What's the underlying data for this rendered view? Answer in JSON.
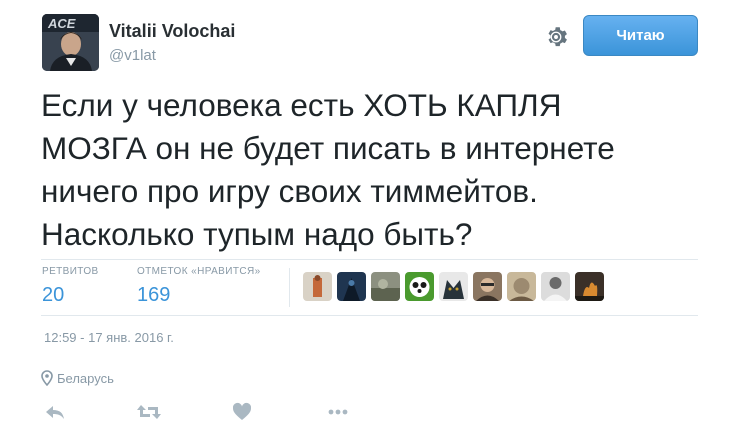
{
  "user": {
    "name": "Vitalii Volochai",
    "handle": "@v1lat",
    "avatar_icon": "user-avatar-photo",
    "avatar_logo_text": "ACE"
  },
  "follow_button": {
    "label": "Читаю",
    "color": "#3b94d9"
  },
  "tweet": {
    "lines": [
      "Если у человека есть ХОТЬ КАПЛЯ",
      "МОЗГА он не будет писать в интернете",
      "ничего про игру своих тиммейтов.",
      "Насколько тупым надо быть?"
    ]
  },
  "stats": {
    "retweets": {
      "label": "РЕТВИТОВ",
      "value": "20"
    },
    "likes": {
      "label": "ОТМЕТОК «НРАВИТСЯ»",
      "value": "169"
    }
  },
  "likers": [
    {
      "icon": "avatar-orange-figure",
      "color": "#c4683a"
    },
    {
      "icon": "avatar-dark-hero",
      "color": "#1f3550"
    },
    {
      "icon": "avatar-gray-scene",
      "color": "#6c7260"
    },
    {
      "icon": "avatar-panda",
      "color": "#4a9a2e"
    },
    {
      "icon": "avatar-dark-creature",
      "color": "#27323a"
    },
    {
      "icon": "avatar-man-glasses",
      "color": "#8a7560"
    },
    {
      "icon": "avatar-blurry-face",
      "color": "#9c8a70"
    },
    {
      "icon": "avatar-man-white-shirt",
      "color": "#b8b8b8"
    },
    {
      "icon": "avatar-fire-scene",
      "color": "#5b4530"
    }
  ],
  "timestamp": "12:59 - 17 янв. 2016 г.",
  "location": "Беларусь",
  "actions": [
    "reply-icon",
    "retweet-icon",
    "like-icon",
    "more-icon"
  ],
  "colors": {
    "link": "#3b94d9",
    "muted": "#8899a6",
    "text": "#1e2529"
  }
}
